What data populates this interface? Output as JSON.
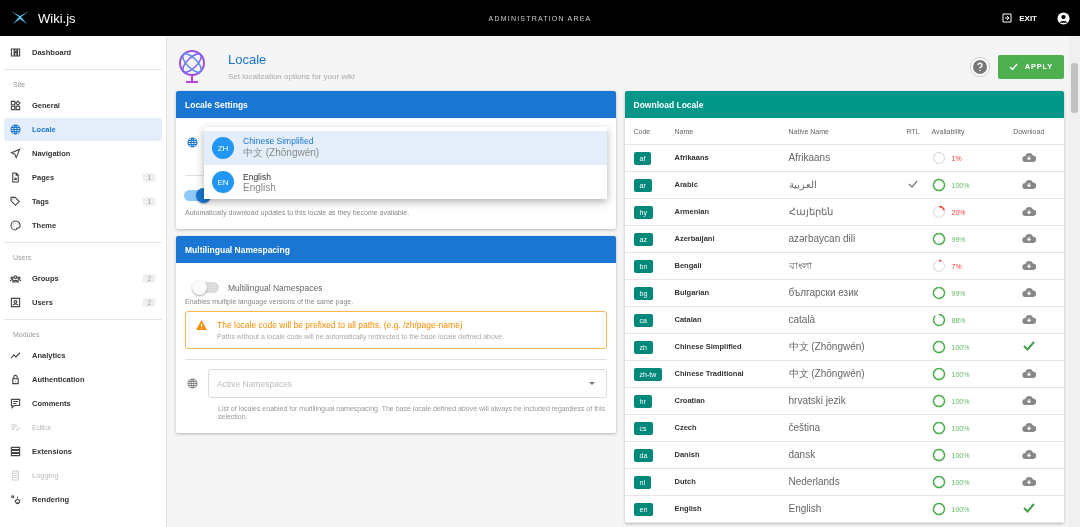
{
  "topbar": {
    "brand": "Wiki.js",
    "title": "ADMINISTRATION AREA",
    "exit": "EXIT"
  },
  "sidebar": {
    "sections": [
      {
        "items": [
          {
            "label": "Dashboard",
            "selected": false,
            "disabled": false
          }
        ]
      },
      {
        "header": "Site",
        "items": [
          {
            "label": "General",
            "selected": false,
            "disabled": false
          },
          {
            "label": "Locale",
            "selected": true,
            "disabled": false
          },
          {
            "label": "Navigation",
            "selected": false,
            "disabled": false
          },
          {
            "label": "Pages",
            "count": "1",
            "selected": false,
            "disabled": false
          },
          {
            "label": "Tags",
            "count": "1",
            "selected": false,
            "disabled": false
          },
          {
            "label": "Theme",
            "selected": false,
            "disabled": false
          }
        ]
      },
      {
        "header": "Users",
        "items": [
          {
            "label": "Groups",
            "count": "2",
            "selected": false,
            "disabled": false
          },
          {
            "label": "Users",
            "count": "2",
            "selected": false,
            "disabled": false
          }
        ]
      },
      {
        "header": "Modules",
        "items": [
          {
            "label": "Analytics",
            "selected": false,
            "disabled": false
          },
          {
            "label": "Authentication",
            "selected": false,
            "disabled": false
          },
          {
            "label": "Comments",
            "selected": false,
            "disabled": false
          },
          {
            "label": "Editor",
            "selected": false,
            "disabled": true
          },
          {
            "label": "Extensions",
            "selected": false,
            "disabled": false
          },
          {
            "label": "Logging",
            "selected": false,
            "disabled": true
          },
          {
            "label": "Rendering",
            "selected": false,
            "disabled": false
          }
        ]
      }
    ]
  },
  "page": {
    "title": "Locale",
    "subtitle": "Set localization options for your wiki",
    "apply": "APPLY"
  },
  "locale_settings": {
    "title": "Locale Settings",
    "auto_update": {
      "on": true,
      "hint": "Automatically download updates to this locale as they become available."
    },
    "dropdown": [
      {
        "code": "ZH",
        "name": "Chinese Simplified",
        "native": "中文 (Zhōngwén)",
        "selected": true
      },
      {
        "code": "EN",
        "name": "English",
        "native": "English",
        "selected": false
      }
    ]
  },
  "namespacing": {
    "title": "Multilingual Namespacing",
    "toggle": {
      "label": "Multilingual Namespaces",
      "on": false,
      "hint": "Enables multiple language versions of the same page."
    },
    "alert": {
      "title": "The locale code will be prefixed to all paths. (e.g. /zh/page-name)",
      "text": "Paths without a locale code will be automatically redirected to the base locale defined above."
    },
    "field": {
      "placeholder": "Active Namespaces",
      "hint": "List of locales enabled for multilingual namespacing. The base locale defined above will always be included regardless of this selection."
    }
  },
  "download": {
    "title": "Download Locale",
    "columns": [
      "Code",
      "Name",
      "Native Name",
      "RTL",
      "Availability",
      "Download"
    ],
    "rows": [
      {
        "code": "af",
        "name": "Afrikaans",
        "native": "Afrikaans",
        "rtl": false,
        "availability": "1%",
        "installed": false
      },
      {
        "code": "ar",
        "name": "Arabic",
        "native": "العربية",
        "rtl": true,
        "availability": "100%",
        "installed": false
      },
      {
        "code": "hy",
        "name": "Armenian",
        "native": "Հայերեն",
        "rtl": false,
        "availability": "20%",
        "installed": false
      },
      {
        "code": "az",
        "name": "Azerbaijani",
        "native": "azərbaycan dili",
        "rtl": false,
        "availability": "99%",
        "installed": false
      },
      {
        "code": "bn",
        "name": "Bengali",
        "native": "বাংলা",
        "rtl": false,
        "availability": "7%",
        "installed": false
      },
      {
        "code": "bg",
        "name": "Bulgarian",
        "native": "български език",
        "rtl": false,
        "availability": "99%",
        "installed": false
      },
      {
        "code": "ca",
        "name": "Catalan",
        "native": "català",
        "rtl": false,
        "availability": "88%",
        "installed": false
      },
      {
        "code": "zh",
        "name": "Chinese Simplified",
        "native": "中文 (Zhōngwén)",
        "rtl": false,
        "availability": "100%",
        "installed": true
      },
      {
        "code": "zh-tw",
        "name": "Chinese Traditional",
        "native": "中文 (Zhōngwén)",
        "rtl": false,
        "availability": "100%",
        "installed": false
      },
      {
        "code": "hr",
        "name": "Croatian",
        "native": "hrvatski jezik",
        "rtl": false,
        "availability": "100%",
        "installed": false
      },
      {
        "code": "cs",
        "name": "Czech",
        "native": "čeština",
        "rtl": false,
        "availability": "100%",
        "installed": false
      },
      {
        "code": "da",
        "name": "Danish",
        "native": "dansk",
        "rtl": false,
        "availability": "100%",
        "installed": false
      },
      {
        "code": "nl",
        "name": "Dutch",
        "native": "Nederlands",
        "rtl": false,
        "availability": "100%",
        "installed": false
      },
      {
        "code": "en",
        "name": "English",
        "native": "English",
        "rtl": false,
        "availability": "100%",
        "installed": true
      }
    ]
  }
}
